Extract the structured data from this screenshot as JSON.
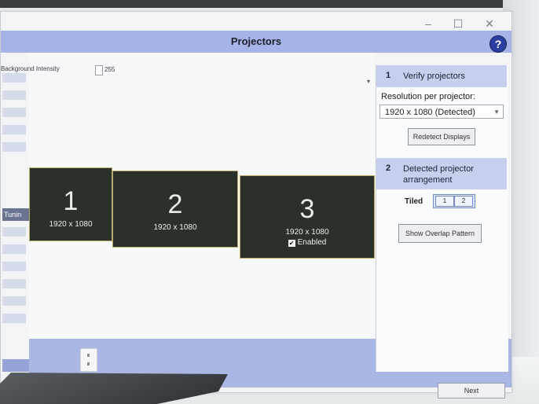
{
  "window": {
    "title": "Projectors",
    "minimize": "–",
    "maximize": "☐",
    "close": "✕",
    "help": "?"
  },
  "left_panel": {
    "tuning_label": "Tunin"
  },
  "canvas": {
    "background_label": "Background Intensity",
    "background_value": "255",
    "projectors": [
      {
        "number": "1",
        "resolution": "1920 x 1080"
      },
      {
        "number": "2",
        "resolution": "1920 x 1080"
      },
      {
        "number": "3",
        "resolution": "1920 x 1080",
        "enabled_label": "Enabled"
      }
    ]
  },
  "right_panel": {
    "step1_number": "1",
    "step1_title": "Verify projectors",
    "resolution_label": "Resolution per projector:",
    "resolution_value": "1920 x 1080 (Detected)",
    "redetect_button": "Redetect Displays",
    "step2_number": "2",
    "step2_title_line1": "Detected projector",
    "step2_title_line2": "arrangement",
    "tiled_label": "Tiled",
    "tiles": [
      "1",
      "2"
    ],
    "overlap_button": "Show Overlap Pattern"
  },
  "footer": {
    "next_button": "Next"
  }
}
